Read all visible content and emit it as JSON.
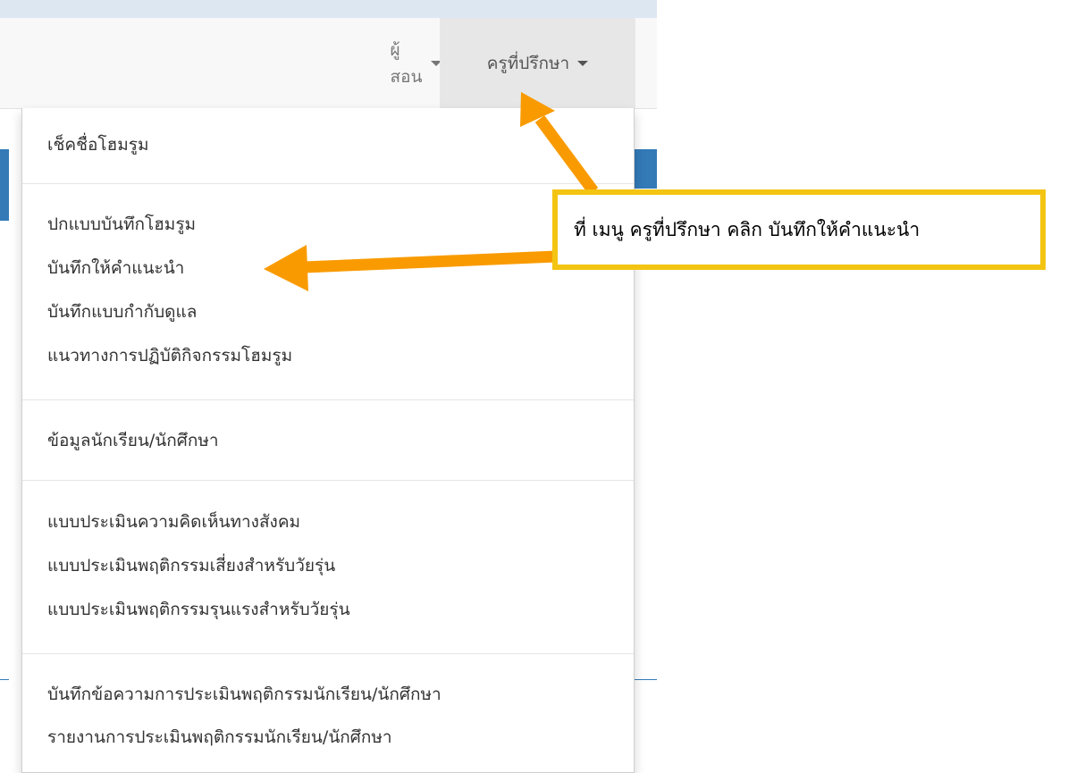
{
  "navbar": {
    "items": [
      {
        "label": "ผู้สอน"
      },
      {
        "label": "ครูที่ปรึกษา"
      }
    ]
  },
  "dropdown": {
    "groups": [
      [
        "เช็คชื่อโฮมรูม"
      ],
      [
        "ปกแบบบันทึกโฮมรูม",
        "บันทึกให้คำแนะนำ",
        "บันทึกแบบกำกับดูแล",
        "แนวทางการปฏิบัติกิจกรรมโฮมรูม"
      ],
      [
        "ข้อมูลนักเรียน/นักศึกษา"
      ],
      [
        "แบบประเมินความคิดเห็นทางสังคม",
        "แบบประเมินพฤติกรรมเสี่ยงสำหรับวัยรุ่น",
        "แบบประเมินพฤติกรรมรุนแรงสำหรับวัยรุ่น"
      ],
      [
        "บันทึกข้อความการประเมินพฤติกรรมนักเรียน/นักศึกษา",
        "รายงานการประเมินพฤติกรรมนักเรียน/นักศึกษา"
      ]
    ]
  },
  "annotation": {
    "text": "ที่ เมนู ครูที่ปรึกษา คลิก บันทึกให้คำแนะนำ"
  },
  "colors": {
    "arrow": "#f99b00",
    "callout_border": "#f3c412",
    "primary": "#337ab7"
  }
}
